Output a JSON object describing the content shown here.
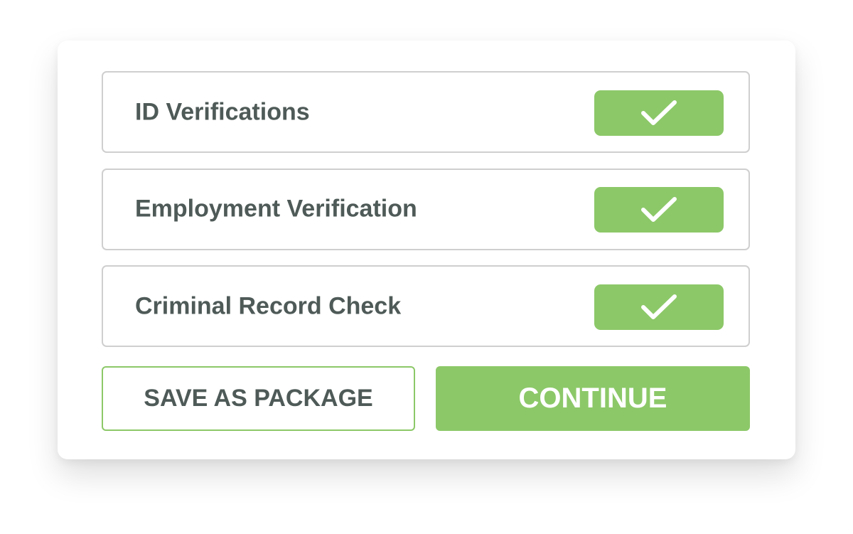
{
  "checks": [
    {
      "label": "ID Verifications",
      "icon": "checkmark-icon",
      "checked": true
    },
    {
      "label": "Employment Verification",
      "icon": "checkmark-icon",
      "checked": true
    },
    {
      "label": "Criminal Record Check",
      "icon": "checkmark-icon",
      "checked": true
    }
  ],
  "actions": {
    "save_label": "SAVE AS PACKAGE",
    "continue_label": "CONTINUE"
  },
  "colors": {
    "accent": "#8cc868",
    "text": "#4e5a57",
    "border": "#cfcfcf",
    "button_text": "#ffffff"
  }
}
